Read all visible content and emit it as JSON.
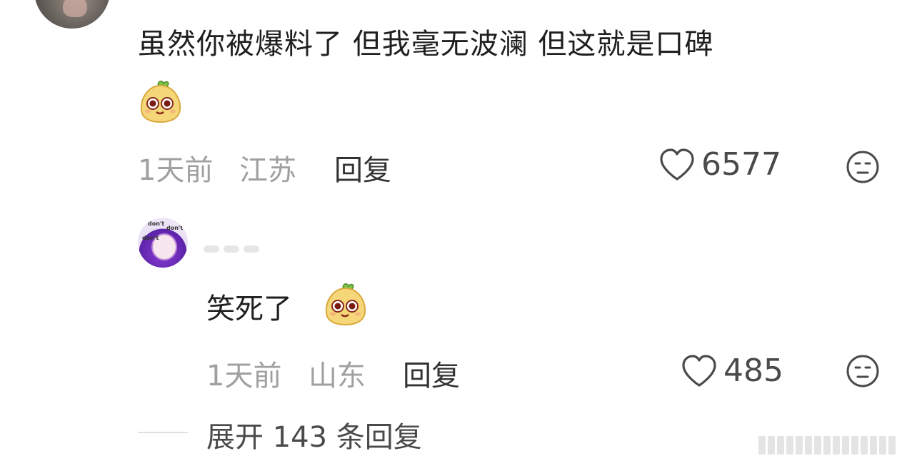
{
  "comment": {
    "text": "虽然你被爆料了 但我毫无波澜 但这就是口碑",
    "sticker": "yellow-blob-sticker",
    "time": "1天前",
    "location": "江苏",
    "reply_label": "回复",
    "like_count": "6577",
    "like_icon": "heart-outline-icon",
    "dislike_icon": "meh-face-icon"
  },
  "reply": {
    "text": "笑死了",
    "sticker": "yellow-blob-sticker",
    "time": "1天前",
    "location": "山东",
    "reply_label": "回复",
    "like_count": "485",
    "like_icon": "heart-outline-icon",
    "dislike_icon": "meh-face-icon"
  },
  "expand": {
    "label": "展开 143 条回复"
  },
  "colors": {
    "text": "#1f1f1f",
    "meta": "#a0a0a0",
    "sticker_body": "#f5d77a"
  }
}
